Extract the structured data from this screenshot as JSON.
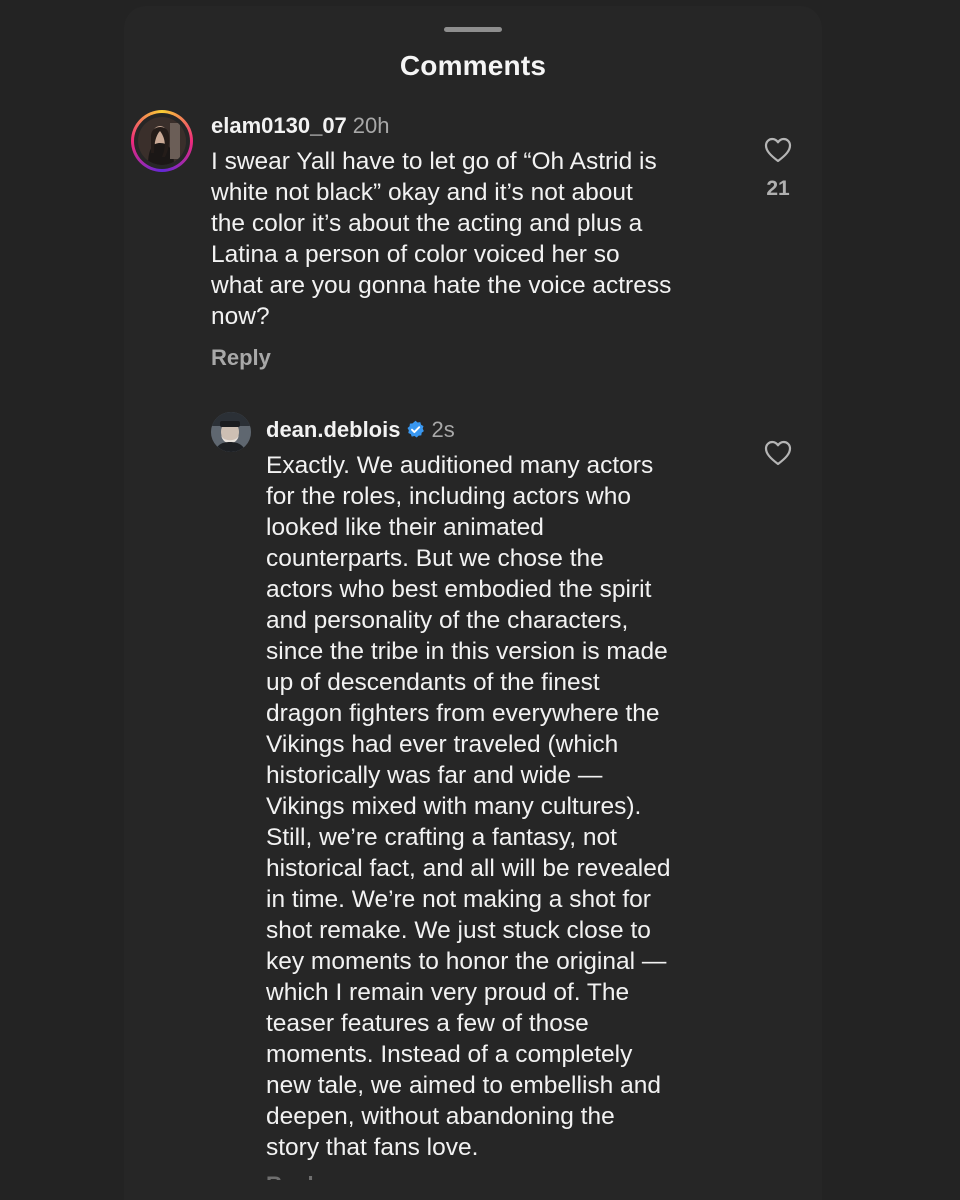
{
  "sheet": {
    "title": "Comments"
  },
  "comments": [
    {
      "username": "elam0130_07",
      "time": "20h",
      "lines": [
        "I swear Yall have to let go of “Oh Astrid is",
        "white not black” okay and it’s not about",
        "the color it’s about the acting and plus a",
        "Latina a person of color voiced her so",
        "what are you gonna hate the voice actress",
        "now?"
      ],
      "reply_label": "Reply",
      "like_count": "21",
      "avatar_icon": "profile-photo-with-story-ring",
      "heart_icon": "heart-outline-icon"
    }
  ],
  "reply": {
    "username": "dean.deblois",
    "verified_icon": "verified-badge-icon",
    "time": "2s",
    "lines": [
      "Exactly. We auditioned many actors",
      "for the roles, including actors who",
      "looked like their animated",
      "counterparts. But we chose the",
      "actors who best embodied the spirit",
      "and personality of the characters,",
      "since the tribe in this version is made",
      "up of descendants of the finest",
      "dragon fighters from everywhere the",
      "Vikings had ever traveled (which",
      "historically was far and wide —",
      "Vikings mixed with many cultures).",
      "Still, we’re crafting a fantasy, not",
      "historical fact, and all will be revealed",
      "in time. We’re not making a shot for",
      "shot remake. We just stuck close to",
      "key moments to honor the original —",
      "which I remain very proud of. The",
      "teaser features a few of those",
      "moments. Instead of a completely",
      "new tale, we aimed to embellish and",
      "deepen, without abandoning the",
      "story that fans love."
    ],
    "reply_label": "Reply",
    "heart_icon": "heart-outline-icon"
  },
  "colors": {
    "background": "#232323",
    "sheet": "#262626",
    "text": "#f2f2f2",
    "secondary_text": "#a8a8a8",
    "verified_blue": "#3897f0"
  }
}
